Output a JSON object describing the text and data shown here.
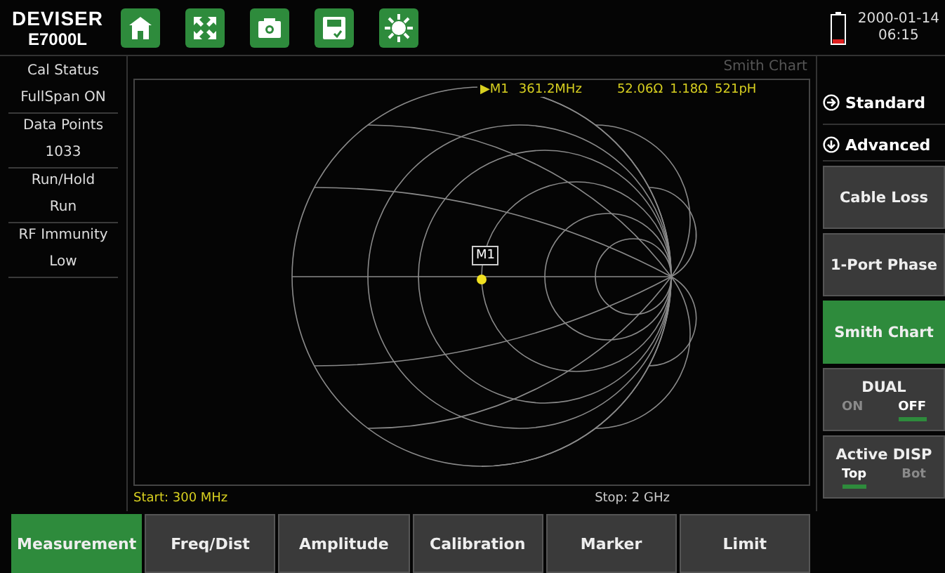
{
  "header": {
    "logo": "DEVISER",
    "model": "E7000L",
    "toolbar": [
      {
        "kind": "home"
      },
      {
        "kind": "fullscreen"
      },
      {
        "kind": "camera"
      },
      {
        "kind": "save"
      },
      {
        "kind": "brightness"
      }
    ],
    "date": "2000-01-14",
    "time": "06:15"
  },
  "status_panel": [
    {
      "label": "Cal Status",
      "value": "FullSpan ON"
    },
    {
      "label": "Data Points",
      "value": "1033"
    },
    {
      "label": "Run/Hold",
      "value": "Run"
    },
    {
      "label": "RF Immunity",
      "value": "Low"
    }
  ],
  "chart": {
    "title": "Smith Chart",
    "marker_readout": {
      "marker": "▶M1",
      "frequency": "361.2MHz",
      "resistance": "52.06Ω",
      "reactance": "1.18Ω",
      "inductance": "521pH"
    },
    "marker_label": "M1",
    "start": "Start: 300 MHz",
    "stop": "Stop: 2 GHz"
  },
  "side_menu": {
    "sections": [
      {
        "label": "Standard",
        "kind": "right"
      },
      {
        "label": "Advanced",
        "kind": "down"
      }
    ],
    "buttons": [
      {
        "kind": "button",
        "label": "Cable Loss",
        "selected": false
      },
      {
        "kind": "button",
        "label": "1-Port Phase",
        "selected": false
      },
      {
        "kind": "button",
        "label": "Smith Chart",
        "selected": true
      },
      {
        "kind": "toggle",
        "label": "DUAL",
        "options": [
          {
            "label": "ON",
            "selected": false
          },
          {
            "label": "OFF",
            "selected": true
          }
        ]
      },
      {
        "kind": "toggle",
        "label": "Active DISP",
        "options": [
          {
            "label": "Top",
            "selected": true
          },
          {
            "label": "Bot",
            "selected": false
          }
        ]
      }
    ]
  },
  "tabs": [
    {
      "label": "Measurement",
      "selected": true
    },
    {
      "label": "Freq/Dist",
      "selected": false
    },
    {
      "label": "Amplitude",
      "selected": false
    },
    {
      "label": "Calibration",
      "selected": false
    },
    {
      "label": "Marker",
      "selected": false
    },
    {
      "label": "Limit",
      "selected": false
    }
  ]
}
